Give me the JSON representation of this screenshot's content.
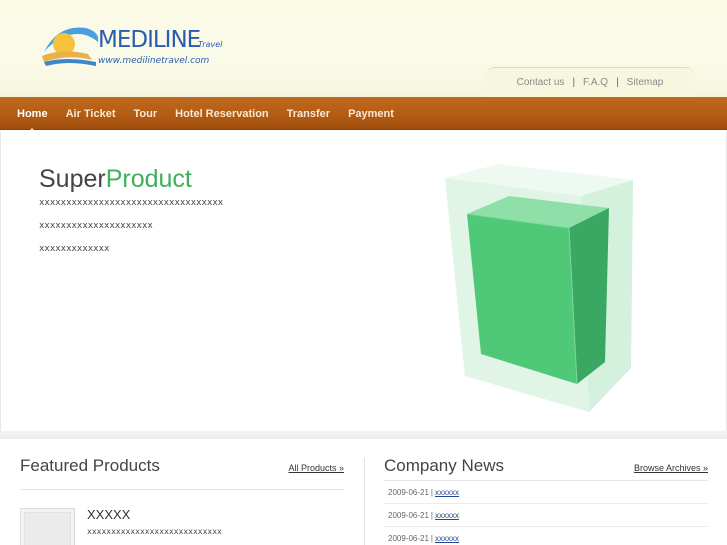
{
  "header": {
    "logo_text": "MEDILINE",
    "logo_subtext": "Travel",
    "logo_url_text": "www.medilinetravel.com",
    "top_links": [
      "Contact us",
      "F.A.Q",
      "Sitemap"
    ],
    "separator": "|"
  },
  "nav": {
    "items": [
      "Home",
      "Air Ticket",
      "Tour",
      "Hotel Reservation",
      "Transfer",
      "Payment"
    ],
    "active": "Home"
  },
  "hero": {
    "title_plain": "Super",
    "title_accent": "Product",
    "lines": [
      "xxxxxxxxxxxxxxxxxxxxxxxxxxxxxxxxxx",
      "xxxxxxxxxxxxxxxxxxxxx",
      "xxxxxxxxxxxxx"
    ]
  },
  "featured": {
    "title": "Featured Products",
    "link": "All Products »",
    "product_name": "XXXXX",
    "product_desc": "xxxxxxxxxxxxxxxxxxxxxxxxxxxx"
  },
  "news": {
    "title": "Company News",
    "link": "Browse Archives »",
    "items": [
      {
        "date": "2009-06-21",
        "text": "xxxxxx"
      },
      {
        "date": "2009-06-21",
        "text": "xxxxxx"
      },
      {
        "date": "2009-06-21",
        "text": "xxxxxx"
      }
    ]
  },
  "colors": {
    "nav_bg": "#b25c14",
    "accent_green": "#3cb05a",
    "logo_blue": "#2a5db0",
    "link_blue": "#23488f"
  }
}
